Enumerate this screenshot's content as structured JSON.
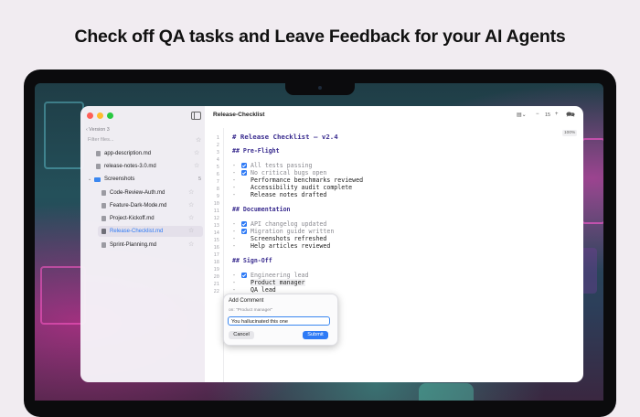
{
  "headline": "Check off QA tasks and Leave Feedback for your AI Agents",
  "window": {
    "title": "Release-Checklist",
    "zoom_value": "15",
    "zoom_minus": "−",
    "zoom_plus": "+",
    "zoom_percent": "100%"
  },
  "sidebar": {
    "back_label": "Version 3",
    "filter_placeholder": "Filter files...",
    "items": [
      {
        "label": "app-description.md"
      },
      {
        "label": "release-notes-3.0.md"
      },
      {
        "label": "Screenshots",
        "count": "5"
      },
      {
        "label": "Code-Review-Auth.md"
      },
      {
        "label": "Feature-Dark-Mode.md"
      },
      {
        "label": "Project-Kickoff.md"
      },
      {
        "label": "Release-Checklist.md"
      },
      {
        "label": "Sprint-Planning.md"
      }
    ]
  },
  "editor": {
    "line_numbers": [
      "1",
      "2",
      "3",
      "4",
      "5",
      "6",
      "7",
      "8",
      "9",
      "10",
      "11",
      "12",
      "13",
      "14",
      "15",
      "16",
      "17",
      "18",
      "19",
      "20",
      "21",
      "22"
    ],
    "lines": {
      "l1": "# Release Checklist — v2.4",
      "l3": "## Pre-Flight",
      "l5": "All tests passing",
      "l6": "No critical bugs open",
      "l7": "Performance benchmarks reviewed",
      "l8": "Accessibility audit complete",
      "l9": "Release notes drafted",
      "l11": "## Documentation",
      "l13": "API changelog updated",
      "l14": "Migration guide written",
      "l15": "Screenshots refreshed",
      "l16": "Help articles reviewed",
      "l18": "## Sign-Off",
      "l20": "Engineering lead",
      "l21": "Product manager",
      "l22": "QA lead"
    },
    "dash": "-"
  },
  "comment_popup": {
    "title": "Add Comment",
    "on_label": "on: \"Product manager\"",
    "input_value": "You hallucinated this one",
    "cancel_label": "Cancel",
    "submit_label": "Submit"
  },
  "colors": {
    "accent": "#2f7bf6",
    "heading": "#3a2c8f",
    "traffic_red": "#fe5f57",
    "traffic_yellow": "#febc2e",
    "traffic_green": "#28c840"
  }
}
